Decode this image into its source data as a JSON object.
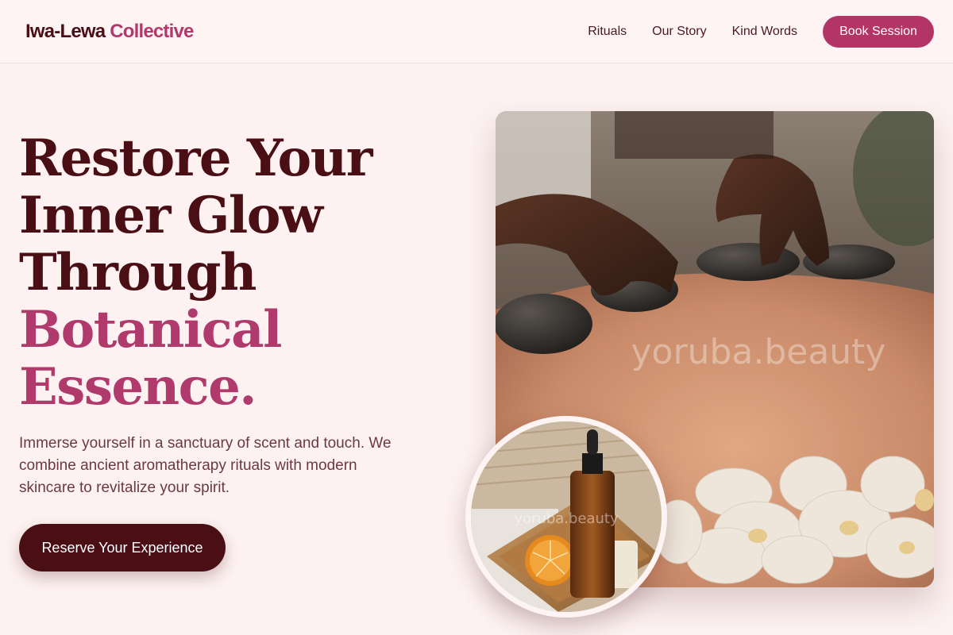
{
  "header": {
    "logo_part1": "Iwa-Lewa",
    "logo_part2": "Collective",
    "nav": [
      "Rituals",
      "Our Story",
      "Kind Words"
    ],
    "cta_label": "Book Session"
  },
  "hero": {
    "title_lines": [
      "Restore Your",
      "Inner Glow",
      "Through"
    ],
    "title_accent_lines": [
      "Botanical",
      "Essence."
    ],
    "description": "Immerse yourself in a sanctuary of scent and touch. We combine ancient aromatherapy rituals with modern skincare to revitalize your spirit.",
    "cta_label": "Reserve Your Experience"
  },
  "images": {
    "main_watermark": "yoruba.beauty",
    "inset_watermark": "yoruba.beauty"
  },
  "colors": {
    "background": "#fdf2f1",
    "primary_dark": "#4a0e15",
    "accent": "#b03a6b",
    "button_accent": "#b23566"
  }
}
